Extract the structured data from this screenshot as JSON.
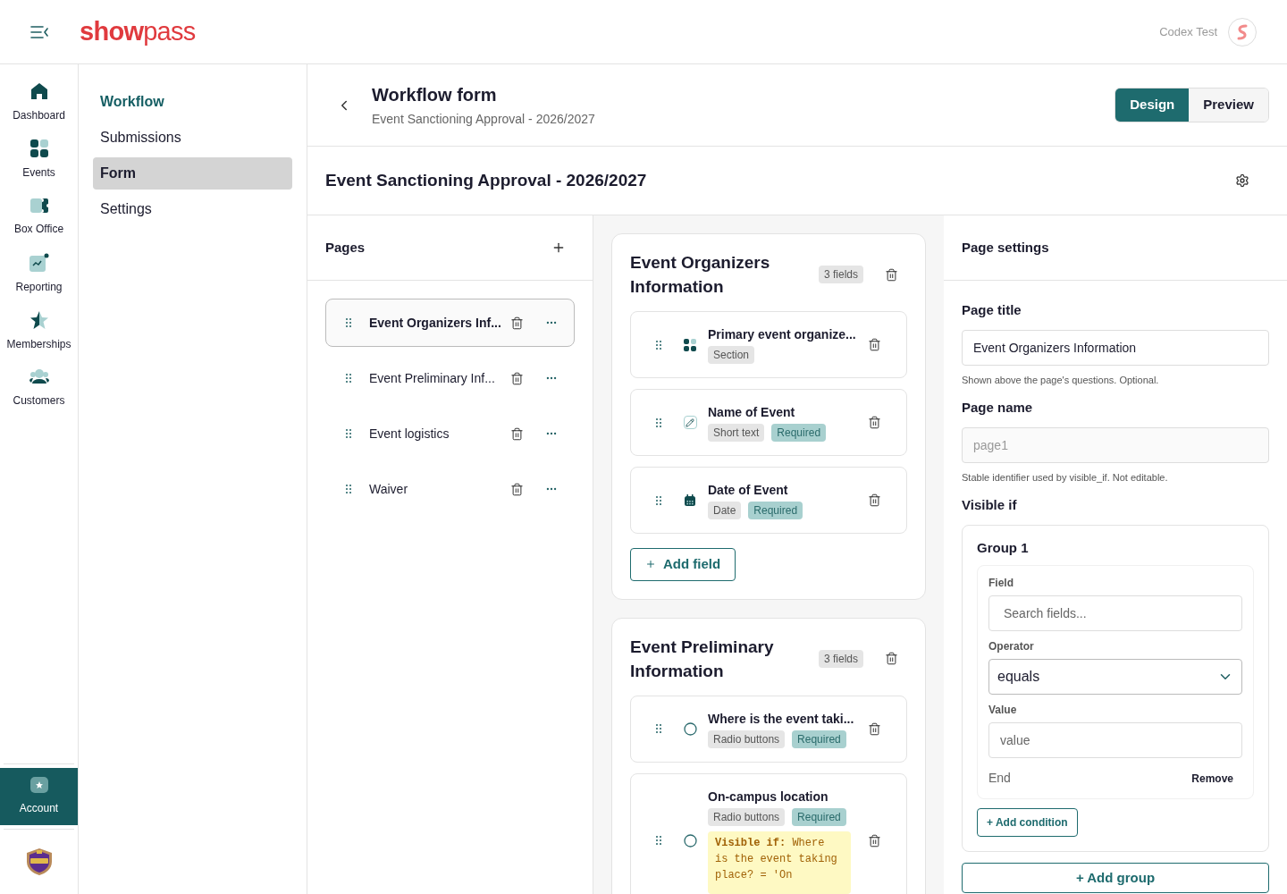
{
  "topbar": {
    "logo": "**show**pass",
    "user_name": "Codex Test"
  },
  "rail": {
    "items": [
      {
        "label": "Dashboard",
        "kind": "home",
        "selected": false
      },
      {
        "label": "Events",
        "kind": "grid",
        "selected": false
      },
      {
        "label": "Box Office",
        "kind": "ticket",
        "selected": false
      },
      {
        "label": "Reporting",
        "kind": "chart",
        "selected": false
      },
      {
        "label": "Memberships",
        "kind": "star",
        "selected": false
      },
      {
        "label": "Customers",
        "kind": "people",
        "selected": false
      }
    ],
    "account": {
      "label": "Account",
      "selected": true
    }
  },
  "subnav": {
    "heading": "Workflow",
    "items": [
      {
        "label": "Submissions",
        "selected": false
      },
      {
        "label": "Form",
        "selected": true
      },
      {
        "label": "Settings",
        "selected": false
      }
    ]
  },
  "page_header": {
    "title": "Workflow form",
    "subtitle": "Event Sanctioning Approval - 2026/2027",
    "modes": [
      {
        "label": "Design",
        "selected": true
      },
      {
        "label": "Preview",
        "selected": false
      }
    ]
  },
  "form_title": "Event Sanctioning Approval - 2026/2027",
  "pages": {
    "title": "Pages",
    "items": [
      {
        "label": "Event Organizers Inf...",
        "selected": true
      },
      {
        "label": "Event Preliminary Inf...",
        "selected": false
      },
      {
        "label": "Event logistics",
        "selected": false
      },
      {
        "label": "Waiver",
        "selected": false
      }
    ]
  },
  "sections": [
    {
      "title": "Event Organizers Information",
      "count": "3 fields",
      "add_field": "Add field",
      "fields": [
        {
          "label": "Primary event organize...",
          "kind": "section",
          "badges": [
            {
              "label": "Section",
              "kind": "type"
            }
          ]
        },
        {
          "label": "Name of Event",
          "kind": "text",
          "badges": [
            {
              "label": "Short text",
              "kind": "type"
            },
            {
              "label": "Required",
              "kind": "required"
            }
          ]
        },
        {
          "label": "Date of Event",
          "kind": "date",
          "badges": [
            {
              "label": "Date",
              "kind": "type"
            },
            {
              "label": "Required",
              "kind": "required"
            }
          ]
        }
      ]
    },
    {
      "title": "Event Preliminary Information",
      "count": "3 fields",
      "fields": [
        {
          "label": "Where is the event taki...",
          "kind": "radio",
          "badges": [
            {
              "label": "Radio buttons",
              "kind": "type"
            },
            {
              "label": "Required",
              "kind": "required"
            }
          ]
        },
        {
          "label": "On-campus location",
          "kind": "radio",
          "badges": [
            {
              "label": "Radio buttons",
              "kind": "type"
            },
            {
              "label": "Required",
              "kind": "required"
            }
          ],
          "condition": "**Visible if:** Where is the event taking place? = 'On"
        }
      ]
    }
  ],
  "settings": {
    "title": "Page settings",
    "page_title": {
      "label": "Page title",
      "value": "Event Organizers Information",
      "help": "Shown above the page's questions. Optional.",
      "disabled": false
    },
    "page_name": {
      "label": "Page name",
      "value": "page1",
      "help": "Stable identifier used by visible_if. Not editable.",
      "disabled": true
    },
    "visible_if": "Visible if",
    "group": {
      "title": "Group 1",
      "field_label": "Field",
      "field_placeholder": "Search fields...",
      "operator_label": "Operator",
      "operator": "equals",
      "value_label": "Value",
      "value_placeholder": "value",
      "end": "End",
      "remove": "Remove",
      "add_condition": "+ Add condition"
    },
    "add_group": "+ Add group"
  }
}
